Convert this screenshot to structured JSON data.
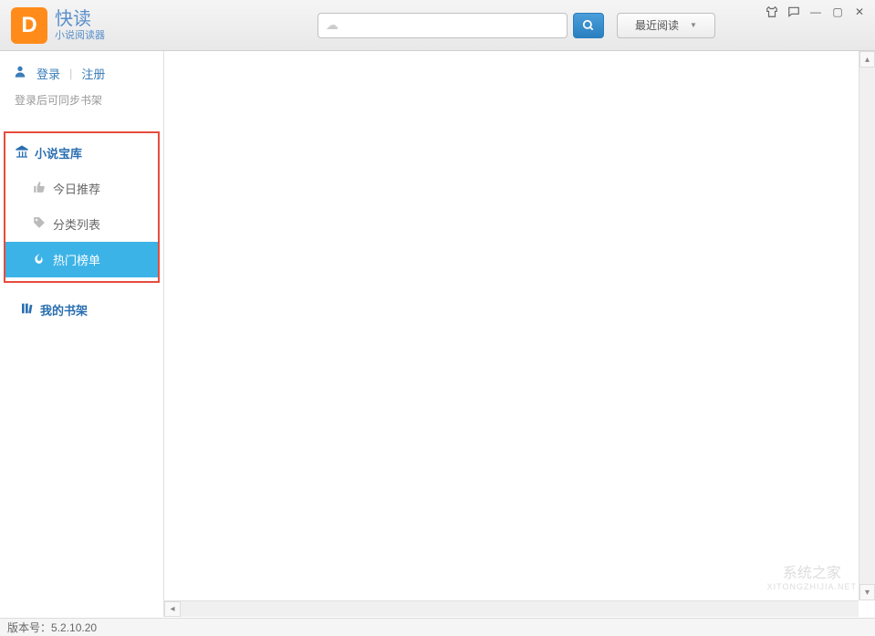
{
  "app": {
    "title": "快读",
    "subtitle": "小说阅读器",
    "logo_letter": "D"
  },
  "header": {
    "search_placeholder": "",
    "recent_read": "最近阅读"
  },
  "auth": {
    "login": "登录",
    "register": "注册",
    "hint": "登录后可同步书架"
  },
  "sidebar": {
    "library_title": "小说宝库",
    "items": [
      {
        "label": "今日推荐"
      },
      {
        "label": "分类列表"
      },
      {
        "label": "热门榜单"
      }
    ],
    "bookshelf_title": "我的书架"
  },
  "watermark": {
    "center": "",
    "corner_main": "系统之家",
    "corner_sub": "XITONGZHIJIA.NET"
  },
  "footer": {
    "version_label": "版本号：",
    "version": "5.2.10.20"
  }
}
